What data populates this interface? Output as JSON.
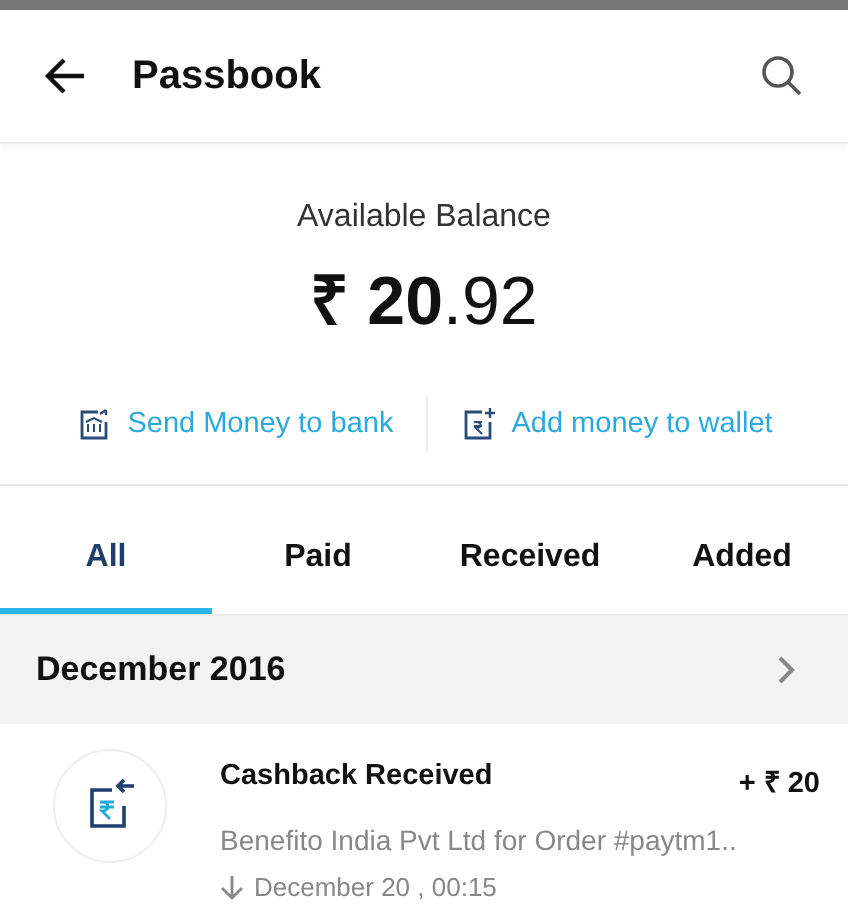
{
  "header": {
    "title": "Passbook"
  },
  "balance": {
    "label": "Available Balance",
    "amount": "**₹ 20**.92"
  },
  "actions": [
    {
      "kind": "bank",
      "label": "Send Money to bank"
    },
    {
      "kind": "wallet",
      "label": "Add money to wallet"
    }
  ],
  "tabs": [
    {
      "label": "All",
      "selected": true
    },
    {
      "label": "Paid",
      "selected": false
    },
    {
      "label": "Received",
      "selected": false
    },
    {
      "label": "Added",
      "selected": false
    }
  ],
  "month": {
    "label": "December 2016"
  },
  "transactions": [
    {
      "title": "Cashback Received",
      "amount": "+ ₹ 20",
      "description": "Benefito India Pvt Ltd for Order #paytm1..",
      "time": "December 20 , 00:15"
    }
  ]
}
